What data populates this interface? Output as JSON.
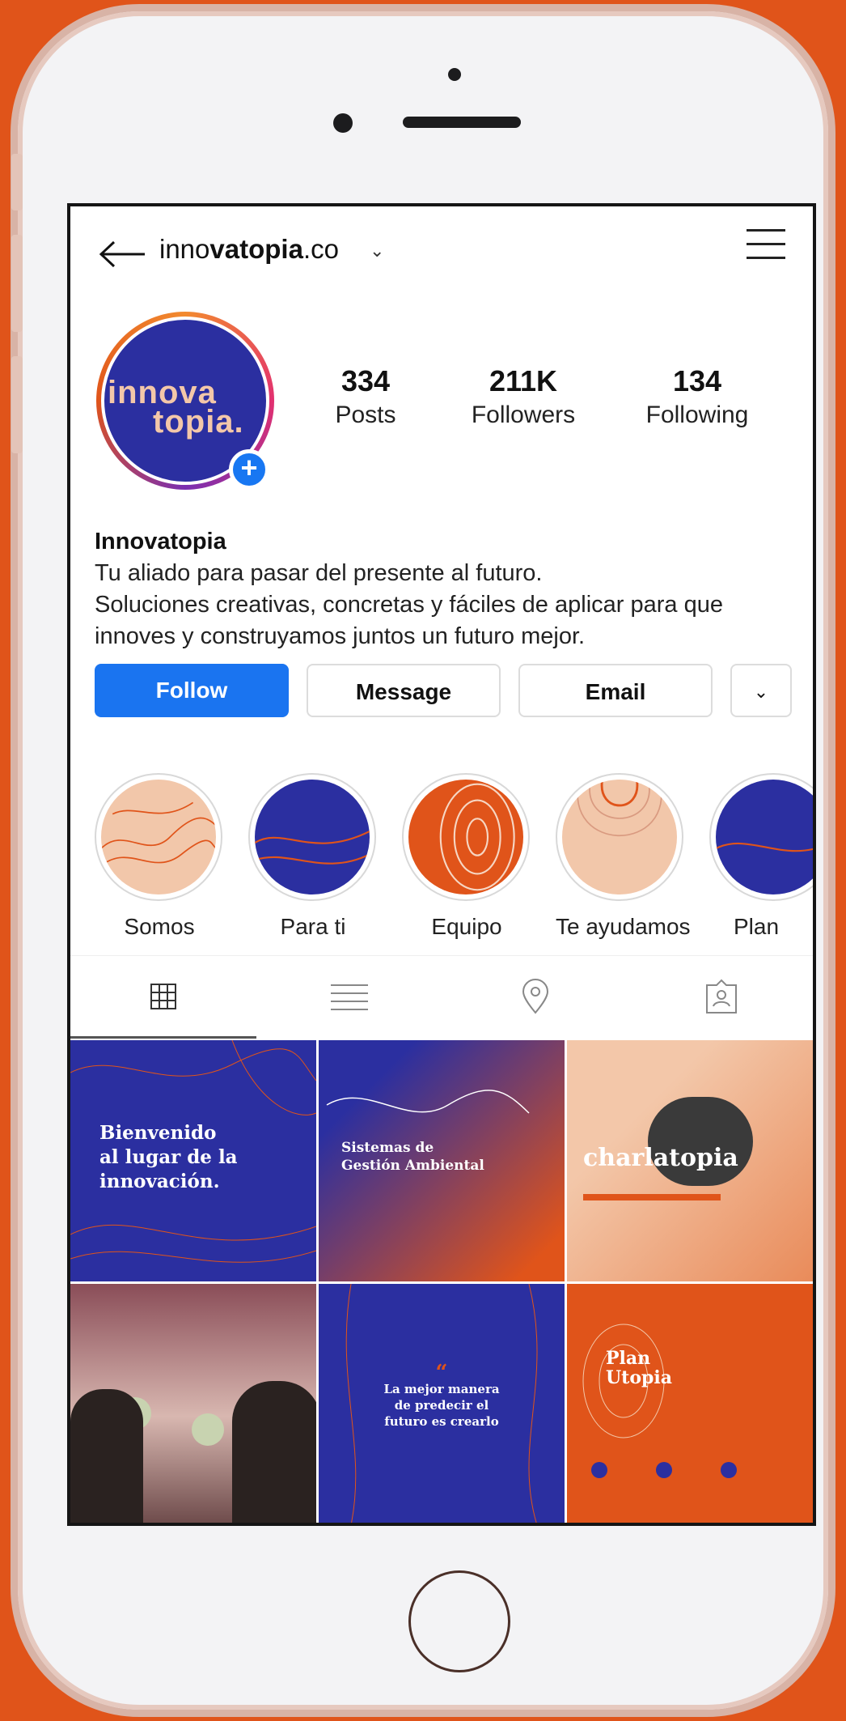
{
  "header": {
    "back_icon": "arrow-left-icon",
    "username_prefix": "inno",
    "username_bold": "vatopia",
    "username_suffix": ".co",
    "menu_icon": "hamburger-icon"
  },
  "profile": {
    "avatar_line1": "innova",
    "avatar_line2": "topia.",
    "stats": [
      {
        "value": "334",
        "label": "Posts"
      },
      {
        "value": "211K",
        "label": "Followers"
      },
      {
        "value": "134",
        "label": "Following"
      }
    ],
    "name": "Innovatopia",
    "bio_line1": "Tu aliado para pasar del presente al futuro.",
    "bio_line2": "Soluciones creativas, concretas y fáciles de aplicar para que",
    "bio_line3": "innoves y construyamos juntos un futuro mejor."
  },
  "actions": {
    "follow": "Follow",
    "message": "Message",
    "email": "Email",
    "more_icon": "chevron-down-icon"
  },
  "highlights": [
    {
      "label": "Somos"
    },
    {
      "label": "Para ti"
    },
    {
      "label": "Equipo"
    },
    {
      "label": "Te ayudamos"
    },
    {
      "label": "Plan"
    }
  ],
  "tabs": [
    {
      "icon": "grid-icon"
    },
    {
      "icon": "list-icon"
    },
    {
      "icon": "location-pin-icon"
    },
    {
      "icon": "tagged-person-icon"
    }
  ],
  "posts": {
    "p1": {
      "line1": "Bienvenido",
      "line2": "al lugar de la",
      "line3": "innovación."
    },
    "p2": {
      "line1": "Sistemas de",
      "line2": "Gestión Ambiental"
    },
    "p3": {
      "title": "charlatopia"
    },
    "p5": {
      "quote": "“",
      "line1": "La mejor manera",
      "line2": "de predecir el",
      "line3": "futuro es crearlo"
    },
    "p6": {
      "line1": "Plan",
      "line2": "Utopia"
    }
  },
  "colors": {
    "brand_blue": "#2b2fa0",
    "brand_orange": "#e0541a",
    "peach": "#f3c7a9",
    "follow_blue": "#1a74f0"
  }
}
